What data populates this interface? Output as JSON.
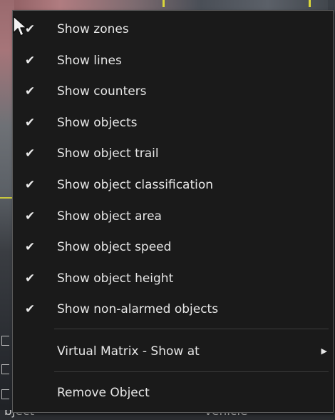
{
  "menu": {
    "items": [
      {
        "label": "Show zones",
        "checked": true
      },
      {
        "label": "Show lines",
        "checked": true
      },
      {
        "label": "Show counters",
        "checked": true
      },
      {
        "label": "Show objects",
        "checked": true
      },
      {
        "label": "Show object trail",
        "checked": true
      },
      {
        "label": "Show object classification",
        "checked": true
      },
      {
        "label": "Show object area",
        "checked": true
      },
      {
        "label": "Show object speed",
        "checked": true
      },
      {
        "label": "Show object height",
        "checked": true
      },
      {
        "label": "Show non-alarmed objects",
        "checked": true
      }
    ],
    "submenu_item": {
      "label": "Virtual Matrix - Show at",
      "has_submenu": true
    },
    "action_item": {
      "label": "Remove Object"
    },
    "check_glyph": "✔",
    "arrow_glyph": "▶"
  },
  "background": {
    "bottom_left_text": "bject",
    "bottom_right_text": "vehicle",
    "accent_yellow": "#d9d63a"
  },
  "colors": {
    "menu_bg": "#1a1a1a",
    "menu_text": "#e6e6e6"
  }
}
